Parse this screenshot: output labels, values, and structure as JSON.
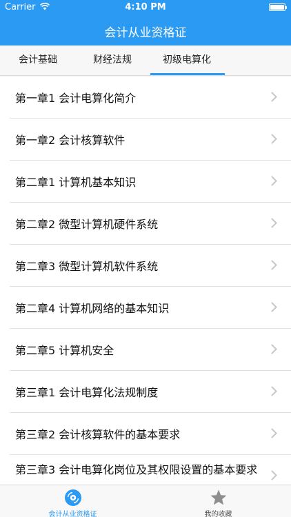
{
  "status_bar": {
    "carrier": "Carrier",
    "time": "4:10 PM"
  },
  "nav": {
    "title": "会计从业资格证"
  },
  "tabs": [
    {
      "label": "会计基础",
      "active": false
    },
    {
      "label": "财经法规",
      "active": false
    },
    {
      "label": "初级电算化",
      "active": true
    }
  ],
  "list": {
    "items": [
      {
        "label": "第一章1 会计电算化简介"
      },
      {
        "label": "第一章2 会计核算软件"
      },
      {
        "label": "第二章1 计算机基本知识"
      },
      {
        "label": "第二章2 微型计算机硬件系统"
      },
      {
        "label": "第二章3 微型计算机软件系统"
      },
      {
        "label": "第二章4 计算机网络的基本知识"
      },
      {
        "label": "第二章5 计算机安全"
      },
      {
        "label": "第三章1 会计电算化法规制度"
      },
      {
        "label": "第三章2 会计核算软件的基本要求"
      },
      {
        "label": "第三章3 会计电算化岗位及其权限设置的基本要求"
      }
    ]
  },
  "tabbar": [
    {
      "label": "会计从业资格证",
      "icon": "disc-icon",
      "active": true
    },
    {
      "label": "我的收藏",
      "icon": "star-icon",
      "active": false
    }
  ],
  "colors": {
    "accent": "#2b9af3",
    "inactive_icon": "#8e8e8e"
  }
}
